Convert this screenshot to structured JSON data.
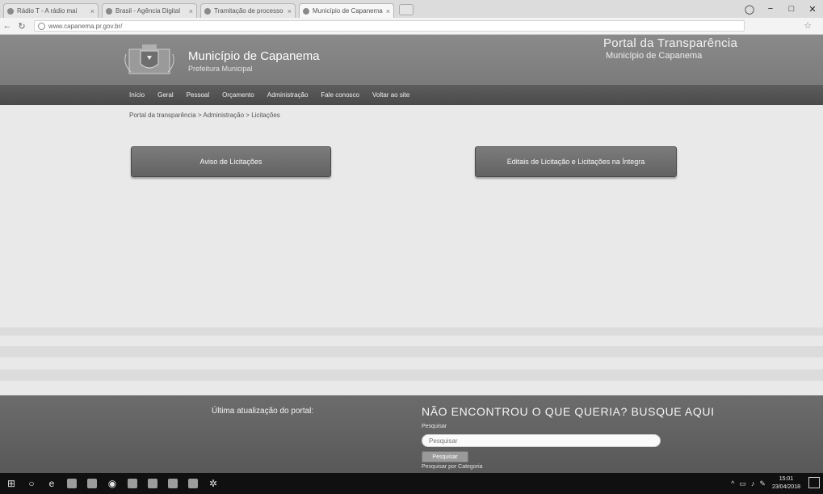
{
  "browser": {
    "tabs": [
      {
        "label": "Rádio T - A rádio mai"
      },
      {
        "label": "Brasil - Agência Digital"
      },
      {
        "label": "Tramitação de processo"
      },
      {
        "label": "Município de Capanema",
        "active": true
      }
    ],
    "url": "www.capanema.pr.gov.br/"
  },
  "site": {
    "title": "Município de Capanema",
    "subtitle": "Prefeitura Municipal",
    "portal_title": "Portal da Transparência",
    "portal_subtitle": "Município de Capanema",
    "nav": [
      "Início",
      "Geral",
      "Pessoal",
      "Orçamento",
      "Administração",
      "Fale conosco",
      "Voltar ao site"
    ],
    "breadcrumb": "Portal da transparência > Administração > Licitações"
  },
  "main": {
    "avisos_button": "Aviso de Licitações",
    "editais_button": "Editais de Licitação e Licitações na Íntegra"
  },
  "footer": {
    "last_update": "Última atualização do portal:",
    "search_title": "NÃO ENCONTROU O QUE QUERIA? BUSQUE AQUI",
    "search_label": "Pesquisar",
    "search_placeholder": "Pesquisar",
    "search_button": "Pesquisar",
    "category_label": "Pesquisar por Categoria"
  },
  "taskbar": {
    "time": "15:01",
    "date": "23/04/2018"
  }
}
